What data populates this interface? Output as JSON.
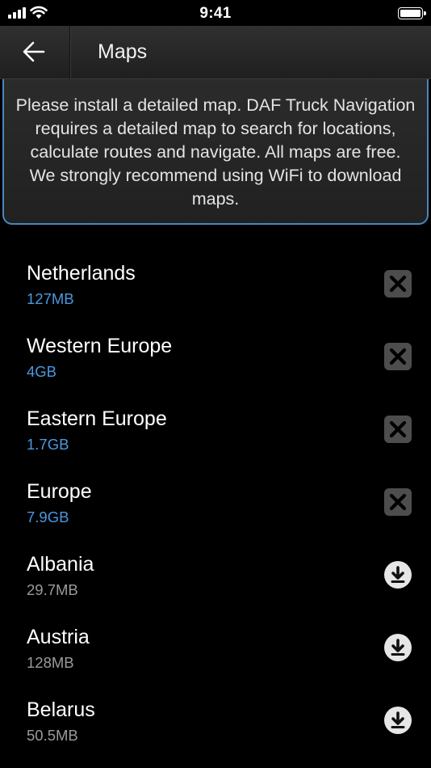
{
  "status_bar": {
    "time": "9:41"
  },
  "header": {
    "title": "Maps"
  },
  "info": {
    "message": "Please install a detailed map. DAF Truck Navigation requires a detailed map to search for locations, calculate routes and navigate. All maps are free. We strongly recommend using WiFi to download maps."
  },
  "maps": [
    {
      "name": "Netherlands",
      "size": "127MB",
      "installed": true
    },
    {
      "name": "Western Europe",
      "size": "4GB",
      "installed": true
    },
    {
      "name": "Eastern Europe",
      "size": "1.7GB",
      "installed": true
    },
    {
      "name": "Europe",
      "size": "7.9GB",
      "installed": true
    },
    {
      "name": "Albania",
      "size": "29.7MB",
      "installed": false
    },
    {
      "name": "Austria",
      "size": "128MB",
      "installed": false
    },
    {
      "name": "Belarus",
      "size": "50.5MB",
      "installed": false
    }
  ],
  "colors": {
    "accent": "#4a86bf",
    "installed_size": "#4a98e0",
    "available_size": "#9a9a9a"
  },
  "icons": {
    "installed_action": "close-icon",
    "available_action": "download-icon",
    "back": "arrow-left-icon"
  }
}
